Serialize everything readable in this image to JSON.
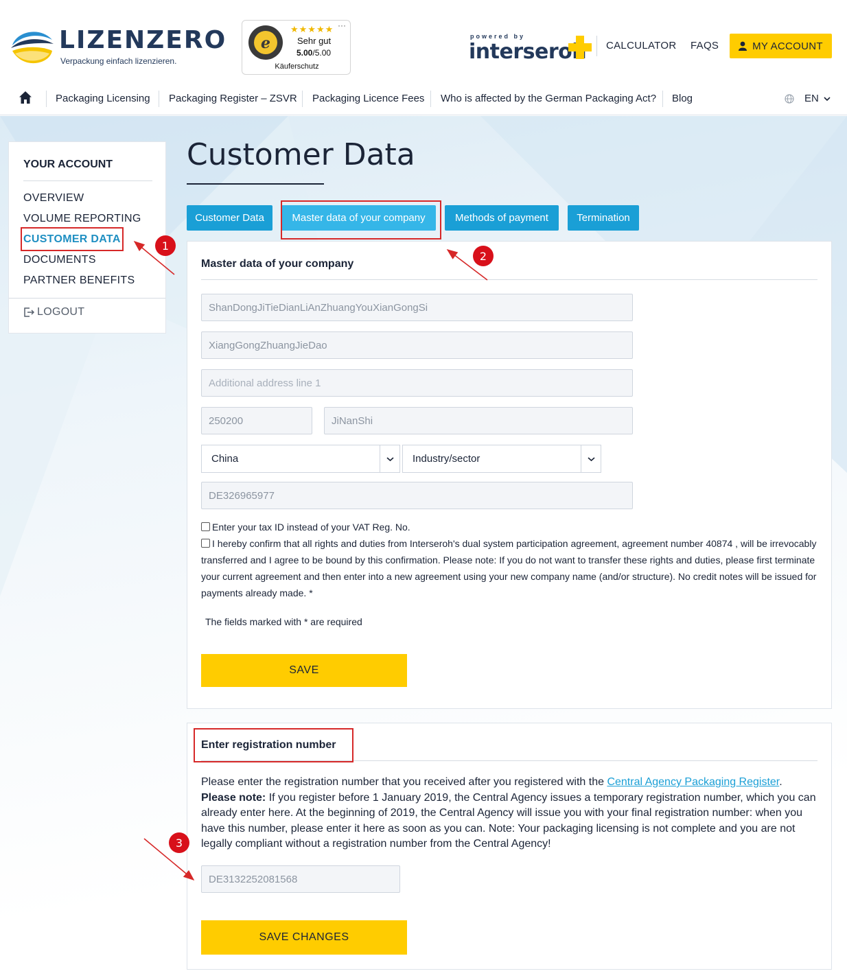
{
  "header": {
    "logo_word": "LIZENZERO",
    "logo_tagline": "Verpackung einfach lizenzieren.",
    "trust_badge": {
      "stars": "★★★★★",
      "rating_text": "Sehr gut",
      "score": "5.00",
      "score_max": "/5.00",
      "caption": "Käuferschutz",
      "more": "···"
    },
    "partner": {
      "powered_by": "powered by",
      "name": "interseroh"
    },
    "links": {
      "calculator": "CALCULATOR",
      "faqs": "FAQS",
      "my_account": "MY ACCOUNT"
    }
  },
  "nav": {
    "items": [
      "Packaging Licensing",
      "Packaging Register – ZSVR",
      "Packaging Licence Fees",
      "Who is affected by the German Packaging Act?",
      "Blog"
    ],
    "language": "EN"
  },
  "sidebar": {
    "title": "YOUR ACCOUNT",
    "items": [
      "OVERVIEW",
      "VOLUME REPORTING",
      "CUSTOMER DATA",
      "DOCUMENTS",
      "PARTNER BENEFITS"
    ],
    "active_index": 2,
    "logout": "LOGOUT"
  },
  "page": {
    "title": "Customer Data",
    "tabs": [
      "Customer Data",
      "Master data of your company",
      "Methods of payment",
      "Termination"
    ],
    "active_tab": 1
  },
  "master_form": {
    "title": "Master data of your company",
    "company_name": "ShanDongJiTieDianLiAnZhuangYouXianGongSi",
    "street": "XiangGongZhuangJieDao",
    "address_line_placeholder": "Additional address line 1",
    "postal_code": "250200",
    "city": "JiNanShi",
    "country": "China",
    "industry": "Industry/sector",
    "vat": "DE326965977",
    "tax_id_checkbox": "Enter your tax ID instead of your VAT Reg. No.",
    "confirm_checkbox": "I hereby confirm that all rights and duties from Interseroh's dual system participation agreement, agreement number 40874 , will be irrevocably transferred and I agree to be bound by this confirmation. Please note: If you do not want to transfer these rights and duties, please first terminate your current agreement and then enter into a new agreement using your new company name (and/or structure). No credit notes will be issued for payments already made. *",
    "required_note": "The fields marked with * are required",
    "save_label": "SAVE"
  },
  "registration": {
    "title": "Enter registration number",
    "text_before_link": "Please enter the registration number that you received after you registered with the ",
    "link_text": "Central Agency Packaging Register",
    "text_after_link": ".",
    "note_label": "Please note:",
    "note_text": " If you register before 1 January 2019, the Central Agency issues a temporary registration number, which you can already enter here. At the beginning of 2019, the Central Agency will issue you with your final registration number: when you have this number, please enter it here as soon as you can. Note: Your packaging licensing is not complete and you are not legally compliant without a registration number from the Central Agency!",
    "number": "DE3132252081568",
    "save_label": "SAVE CHANGES"
  },
  "annotations": {
    "one": "1",
    "two": "2",
    "three": "3"
  },
  "colors": {
    "accent_yellow": "#ffcc00",
    "tab_blue": "#1a9fd6",
    "active_link": "#1f8fc2",
    "navy": "#1b2437",
    "annotation_red": "#d62828"
  },
  "icons": {
    "home": "home-icon",
    "user": "user-icon",
    "globe": "globe-icon",
    "chevron": "chevron-down-icon",
    "logout": "logout-icon"
  }
}
